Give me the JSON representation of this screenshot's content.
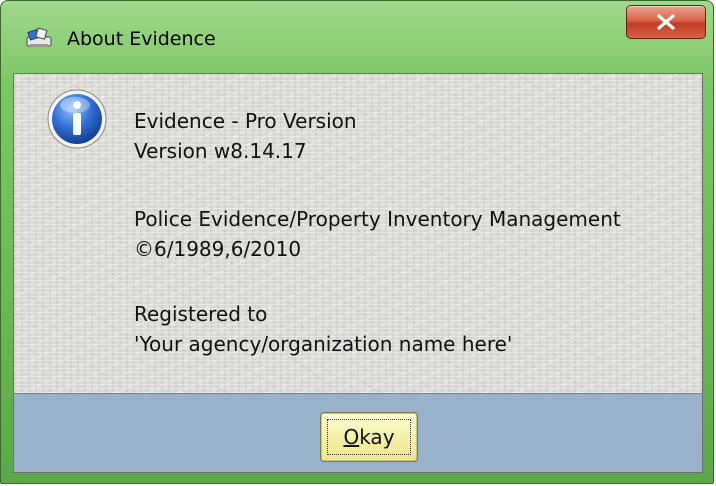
{
  "window": {
    "title": "About Evidence",
    "close_glyph": "x"
  },
  "content": {
    "product_name": "Evidence - Pro Version",
    "version": "Version w8.14.17",
    "description": "Police Evidence/Property Inventory Management",
    "copyright": "©6/1989,6/2010",
    "registered_label": "Registered to",
    "registered_name": "'Your agency/organization name here'"
  },
  "footer": {
    "okay_underlined": "O",
    "okay_rest": "kay"
  },
  "icons": {
    "app": "evidence-app-icon",
    "info": "info-icon",
    "close": "close-icon"
  },
  "colors": {
    "titlebar": "#7cc765",
    "close_button": "#c23b22",
    "footer": "#9ab1cb",
    "okay_button": "#f6f1a8"
  }
}
